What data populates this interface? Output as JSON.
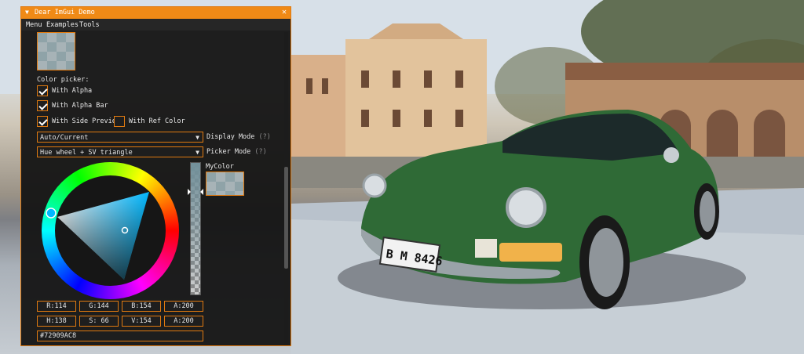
{
  "window": {
    "title": "Dear ImGui Demo",
    "close_glyph": "✕",
    "collapse_glyph": "▼"
  },
  "menu": {
    "items": [
      "Menu",
      "Examples",
      "Tools"
    ]
  },
  "color_picker": {
    "heading": "Color picker:",
    "options": [
      {
        "label": "With Alpha",
        "checked": true
      },
      {
        "label": "With Alpha Bar",
        "checked": true
      },
      {
        "label": "With Side Preview",
        "checked": true
      },
      {
        "label": "With Ref Color",
        "checked": false
      }
    ],
    "display_mode": {
      "value": "Auto/Current",
      "label": "Display Mode",
      "help": "(?)"
    },
    "picker_mode": {
      "value": "Hue wheel + SV triangle",
      "label": "Picker Mode",
      "help": "(?)"
    },
    "preview_label": "MyColor",
    "rgba": {
      "r": "R:114",
      "g": "G:144",
      "b": "B:154",
      "a": "A:200"
    },
    "hsva": {
      "h": "H:138",
      "s": "S: 66",
      "v": "V:154",
      "a": "A:200"
    },
    "hex": "#72909AC8",
    "color_hex": "#72909A",
    "alpha_fraction": 0.78
  },
  "colors": {
    "accent": "#F08A16",
    "window_bg": "#161616"
  },
  "scene": {
    "plate": "B M 8426"
  }
}
